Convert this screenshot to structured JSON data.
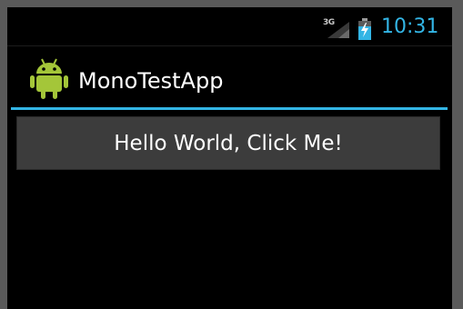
{
  "status_bar": {
    "network_type": "3G",
    "clock": "10:31",
    "signal_icon": "signal-icon",
    "battery_icon": "battery-charging-icon",
    "accent_color": "#33b5e5"
  },
  "action_bar": {
    "app_icon": "android-robot-icon",
    "title": "MonoTestApp",
    "app_icon_color": "#a4c639"
  },
  "content": {
    "button_label": "Hello World, Click Me!"
  }
}
